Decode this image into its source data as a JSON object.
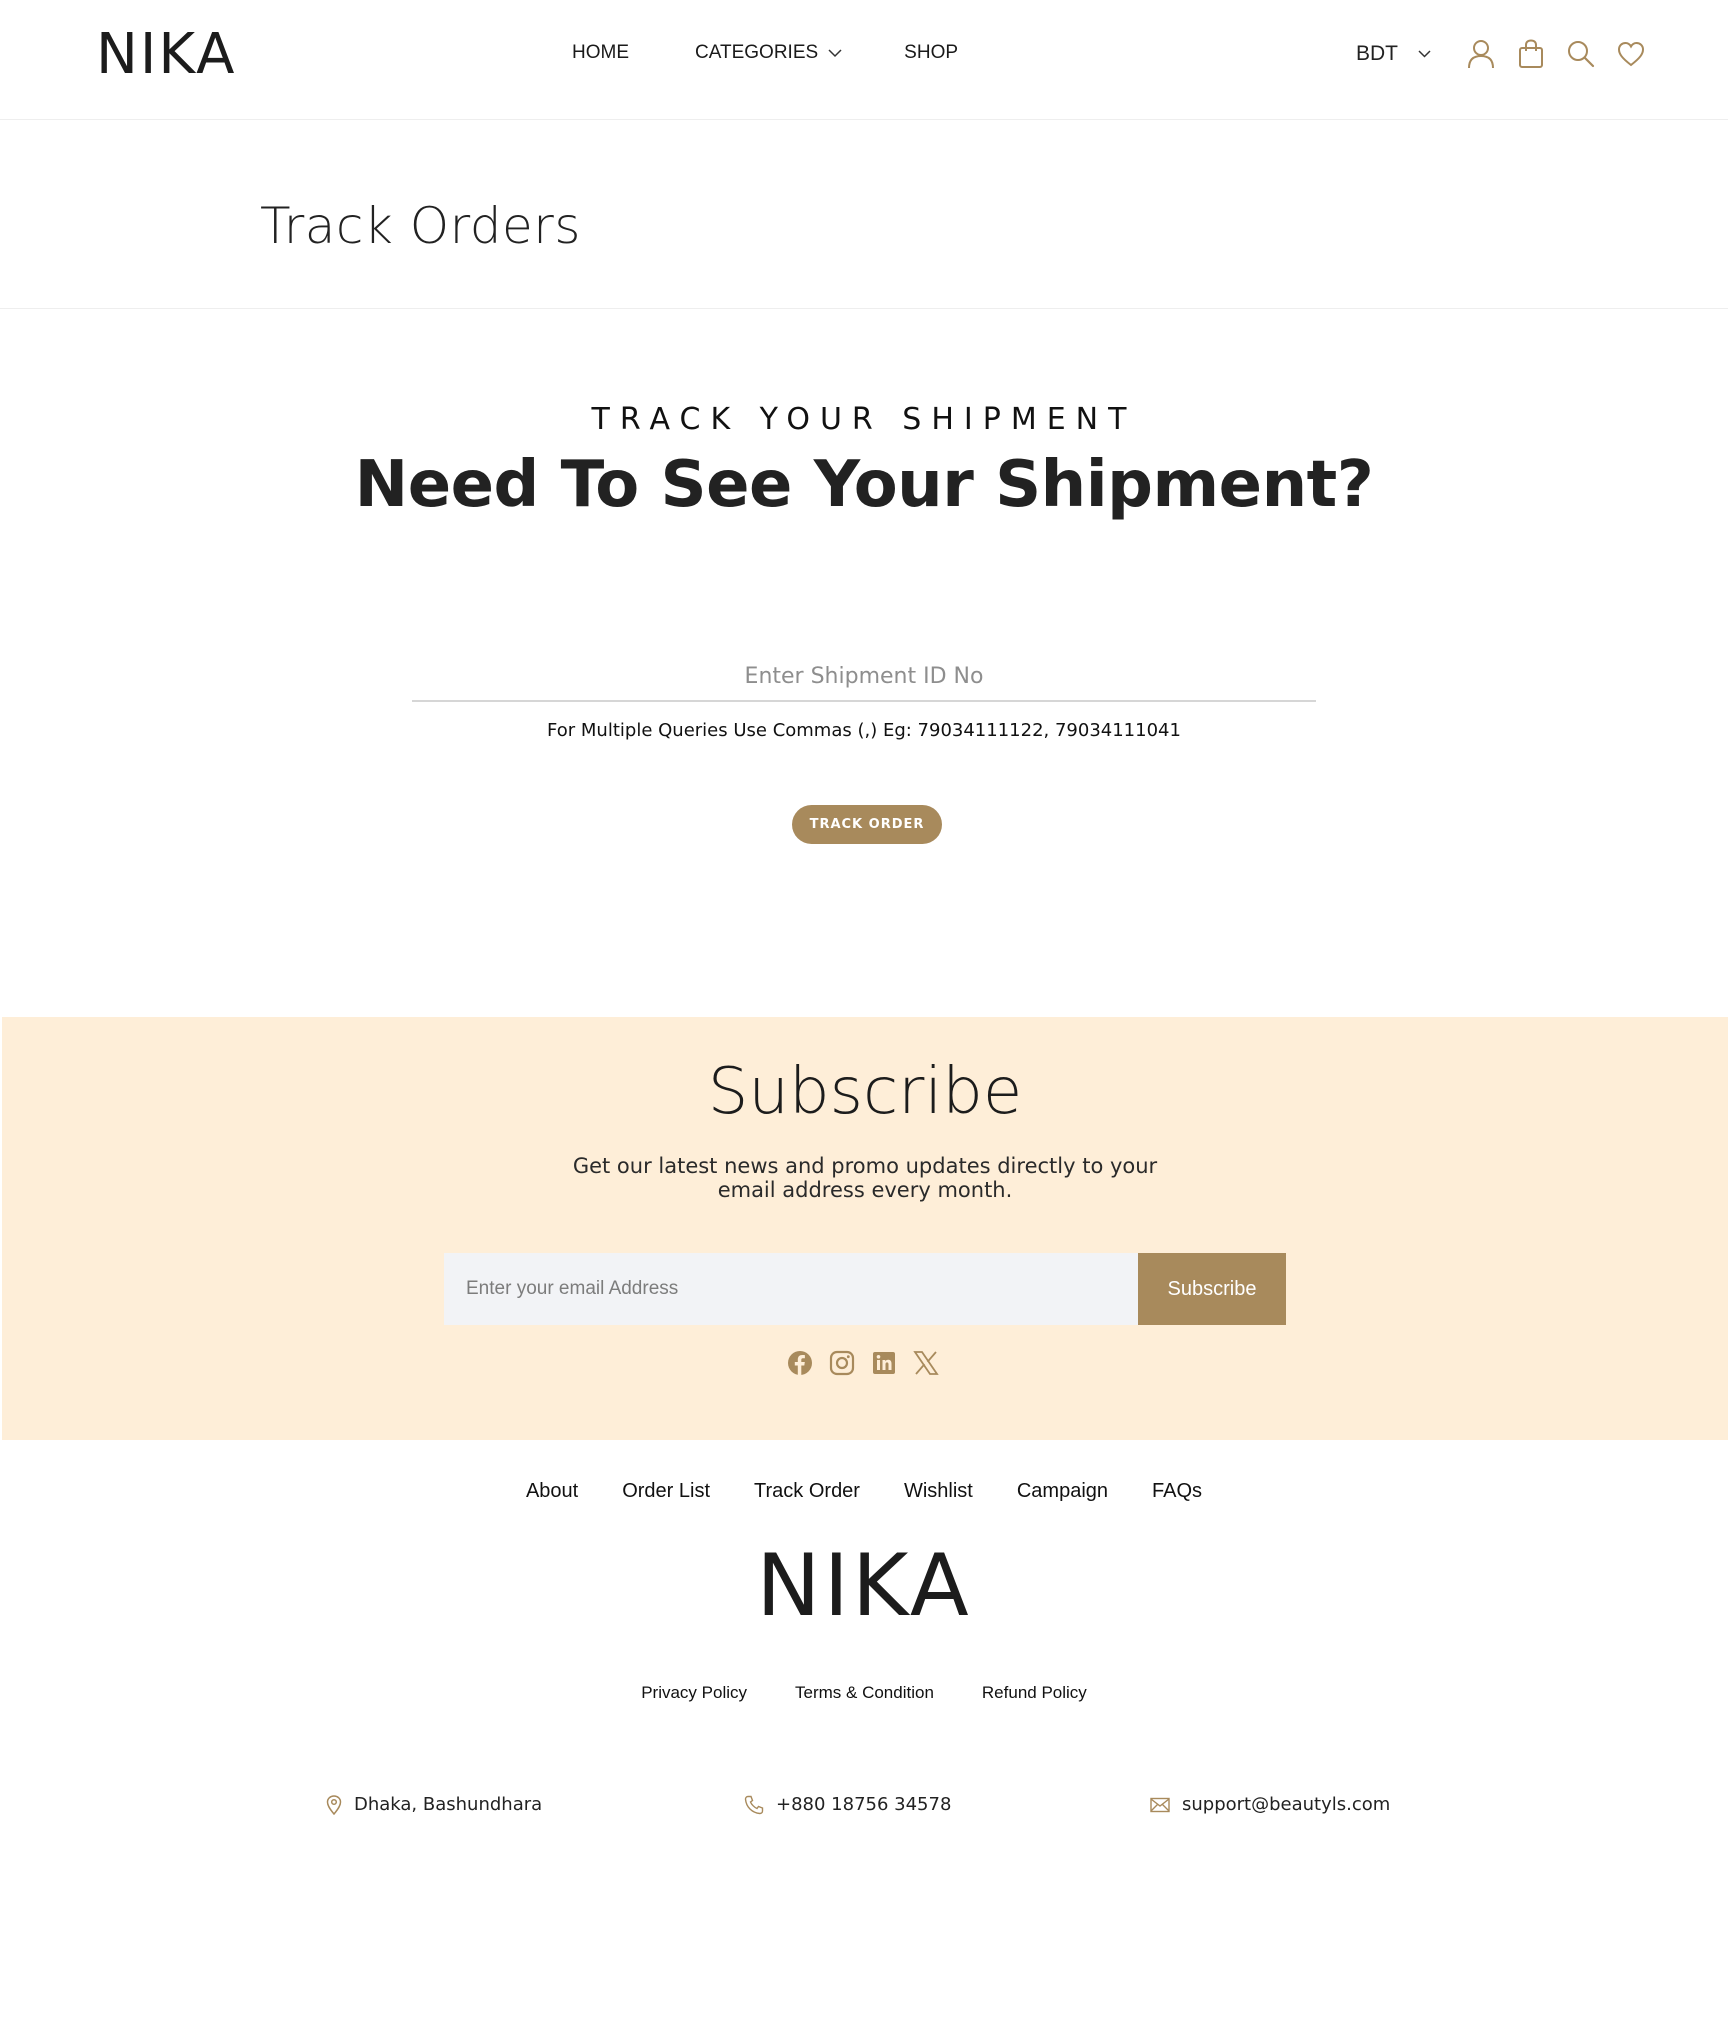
{
  "header": {
    "logo": "NIKA",
    "nav": {
      "home": "HOME",
      "categories": "CATEGORIES",
      "shop": "SHOP"
    },
    "currency": "BDT",
    "icons": [
      "user-icon",
      "shopping-bag-icon",
      "search-icon",
      "heart-icon"
    ]
  },
  "page": {
    "title": "Track Orders"
  },
  "track": {
    "eyebrow": "TRACK YOUR SHIPMENT",
    "headline": "Need To See Your Shipment?",
    "input_placeholder": "Enter Shipment ID No",
    "hint": "For Multiple Queries Use Commas (,) Eg: 79034111122, 79034111041",
    "button": "TRACK ORDER"
  },
  "subscribe": {
    "title": "Subscribe",
    "desc_line1": "Get our latest news and promo updates directly to your",
    "desc_line2": "email address every month.",
    "email_placeholder": "Enter your email Address",
    "button": "Subscribe",
    "socials": [
      "facebook-icon",
      "instagram-icon",
      "linkedin-icon",
      "x-icon"
    ]
  },
  "footer": {
    "links": [
      "About",
      "Order List",
      "Track Order",
      "Wishlist",
      "Campaign",
      "FAQs"
    ],
    "logo": "NIKA",
    "policies": [
      "Privacy Policy",
      "Terms & Condition",
      "Refund Policy"
    ],
    "address": "Dhaka, Bashundhara",
    "phone": "+880 18756 34578",
    "email": "support@beautyls.com"
  },
  "colors": {
    "accent": "#a88a5c",
    "subscribe_bg": "#feeed8",
    "text": "#222222"
  }
}
